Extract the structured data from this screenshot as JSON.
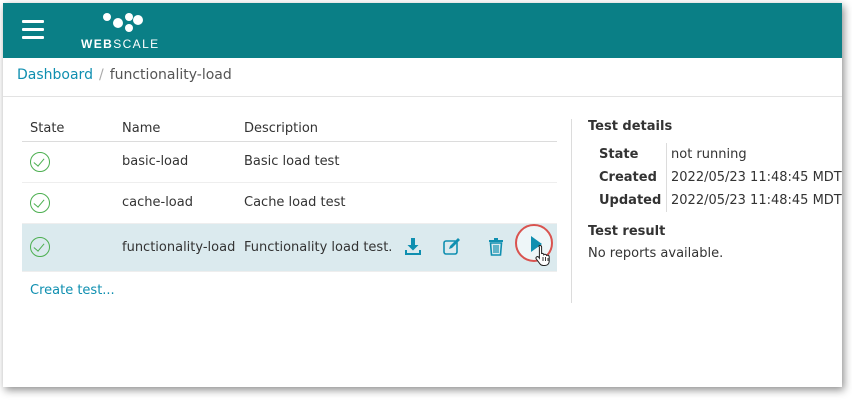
{
  "brand": {
    "name_bold": "WEB",
    "name_rest": "SCALE",
    "accent": "#0a7f86"
  },
  "breadcrumb": {
    "root": "Dashboard",
    "current": "functionality-load"
  },
  "table": {
    "headers": [
      "State",
      "Name",
      "Description"
    ],
    "rows": [
      {
        "name": "basic-load",
        "description": "Basic load test"
      },
      {
        "name": "cache-load",
        "description": "Cache load test"
      },
      {
        "name": "functionality-load",
        "description": "Functionality load test."
      }
    ]
  },
  "create_link": "Create test...",
  "details": {
    "title": "Test details",
    "rows": [
      {
        "key": "State",
        "value": "not running"
      },
      {
        "key": "Created",
        "value": "2022/05/23 11:48:45 MDT"
      },
      {
        "key": "Updated",
        "value": "2022/05/23 11:48:45 MDT"
      }
    ]
  },
  "result": {
    "title": "Test result",
    "text": "No reports available."
  },
  "icons": [
    "menu-icon",
    "download-icon",
    "edit-icon",
    "trash-icon",
    "play-icon",
    "pointer-cursor-icon",
    "check-circle-icon"
  ]
}
